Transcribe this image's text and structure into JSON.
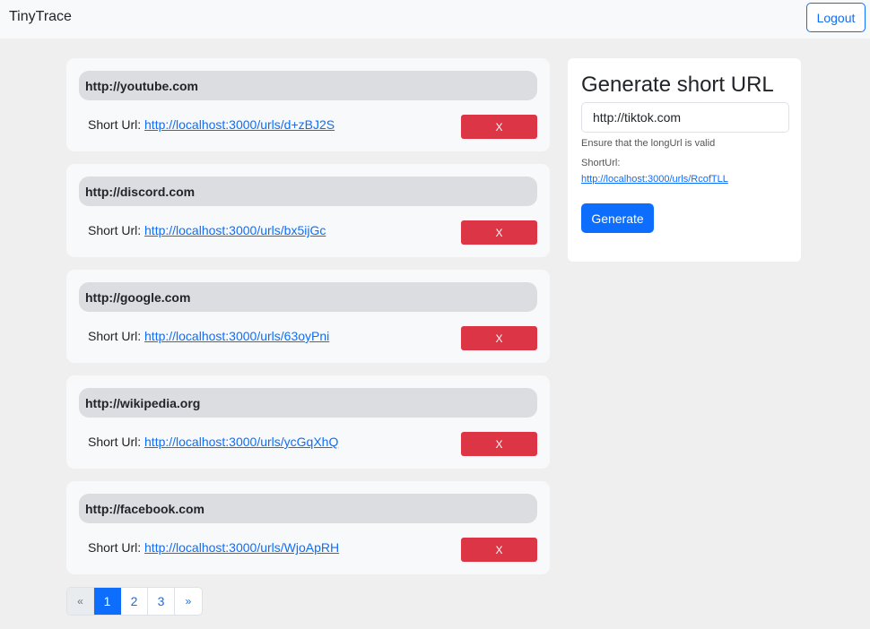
{
  "navbar": {
    "brand": "TinyTrace",
    "logout_label": "Logout"
  },
  "urls": [
    {
      "long_url": "http://youtube.com",
      "short_prefix": "Short Url:",
      "short_url": "http://localhost:3000/urls/d+zBJ2S",
      "delete_label": "X"
    },
    {
      "long_url": "http://discord.com",
      "short_prefix": "Short Url:",
      "short_url": "http://localhost:3000/urls/bx5ijGc",
      "delete_label": "X"
    },
    {
      "long_url": "http://google.com",
      "short_prefix": "Short Url:",
      "short_url": "http://localhost:3000/urls/63oyPni",
      "delete_label": "X"
    },
    {
      "long_url": "http://wikipedia.org",
      "short_prefix": "Short Url:",
      "short_url": "http://localhost:3000/urls/ycGqXhQ",
      "delete_label": "X"
    },
    {
      "long_url": "http://facebook.com",
      "short_prefix": "Short Url:",
      "short_url": "http://localhost:3000/urls/WjoApRH",
      "delete_label": "X"
    }
  ],
  "pagination": {
    "prev": "«",
    "pages": [
      "1",
      "2",
      "3"
    ],
    "active_page": "1",
    "next": "»"
  },
  "generator": {
    "title": "Generate short URL",
    "input_value": "http://tiktok.com",
    "help_text": "Ensure that the longUrl is valid",
    "short_url_label": "ShortUrl:",
    "short_url_value": "http://localhost:3000/urls/RcofTLL",
    "button_label": "Generate"
  },
  "colors": {
    "primary": "#0d6efd",
    "danger": "#dc3545",
    "background": "#efefef"
  }
}
